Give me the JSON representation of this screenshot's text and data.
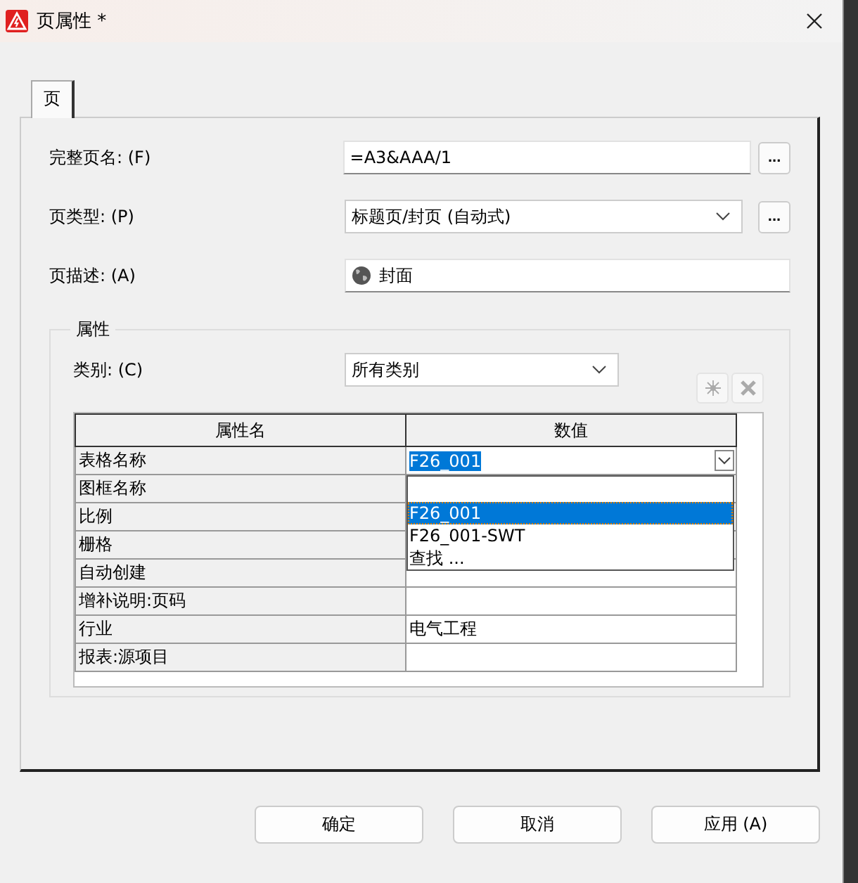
{
  "window": {
    "title": "页属性 *"
  },
  "tabs": [
    {
      "label": "页",
      "selected": true
    }
  ],
  "fields": [
    {
      "kind": "text",
      "label": "完整页名: (F)",
      "value": "=A3&AAA/1",
      "button": "..."
    },
    {
      "kind": "combo",
      "label": "页类型: (P)",
      "value": "标题页/封页 (自动式)",
      "button": "..."
    },
    {
      "kind": "globe-text",
      "label": "页描述: (A)",
      "value": "封面"
    }
  ],
  "properties": {
    "title": "属性",
    "category": {
      "label": "类别: (C)",
      "value": "所有类别"
    },
    "tools": [
      {
        "kind": "new",
        "disabled": true
      },
      {
        "kind": "delete",
        "disabled": true
      }
    ],
    "columns": [
      "属性名",
      "数值"
    ],
    "rows": [
      {
        "name": "表格名称",
        "value": "F26_001",
        "editing": true
      },
      {
        "name": "图框名称"
      },
      {
        "name": "比例"
      },
      {
        "name": "栅格"
      },
      {
        "name": "自动创建"
      },
      {
        "name": "增补说明:页码"
      },
      {
        "name": "行业",
        "value": "电气工程"
      },
      {
        "name": "报表:源项目"
      }
    ],
    "dropdown": [
      {
        "label": "F26_001",
        "selected": true
      },
      {
        "label": "F26_001-SWT",
        "selected": false
      },
      {
        "label": "查找 ...",
        "selected": false
      }
    ]
  },
  "buttons": [
    "确定",
    "取消",
    "应用 (A)"
  ]
}
